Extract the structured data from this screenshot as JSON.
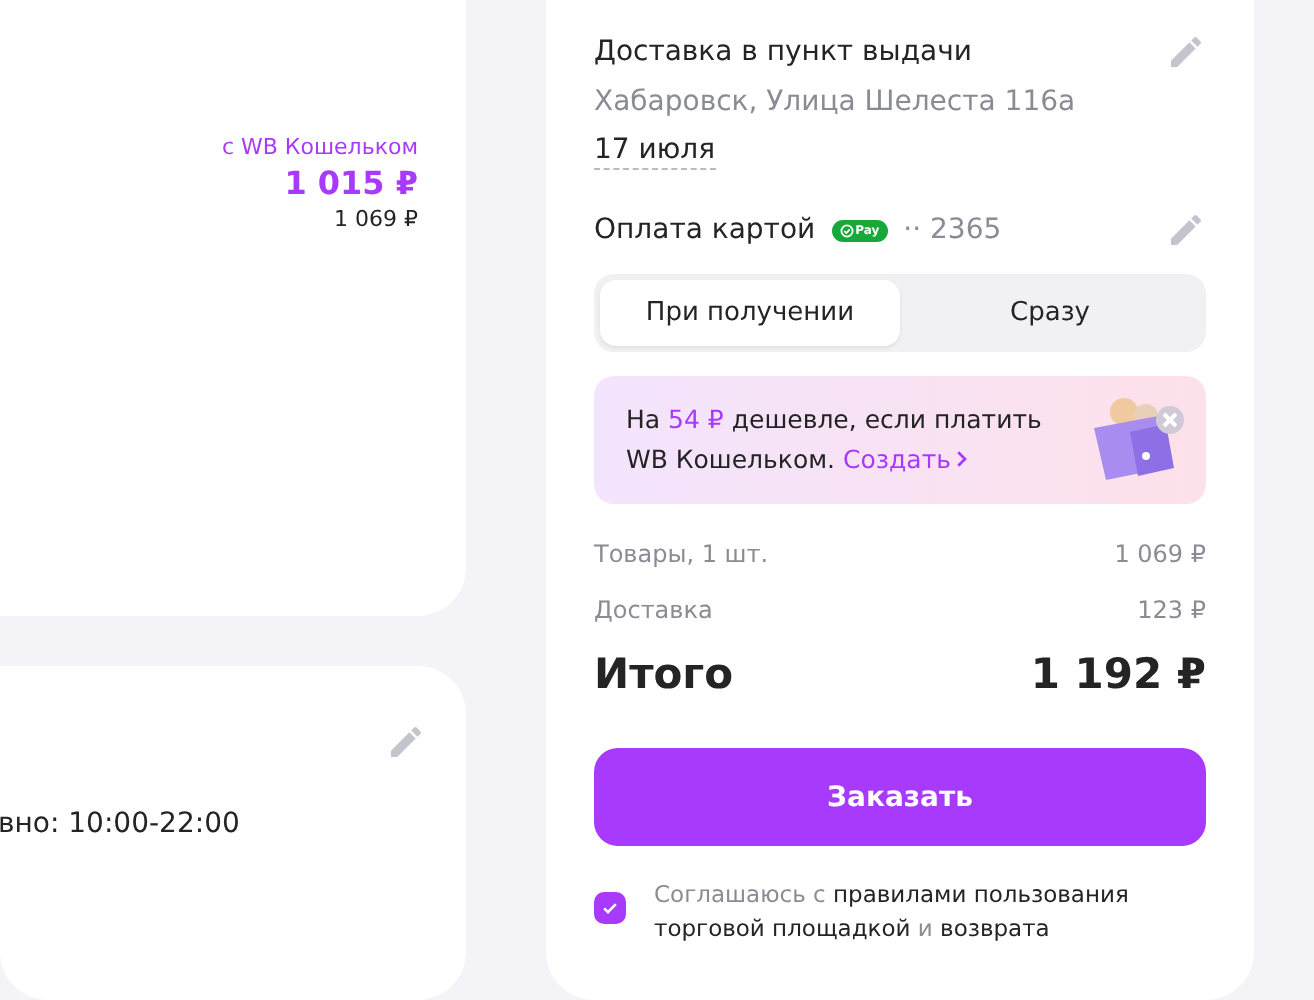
{
  "product_card": {
    "wallet_label": "с WB Кошельком",
    "wallet_price": "1 015 ₽",
    "price": "1 069 ₽"
  },
  "pickup_card": {
    "hours": "вно: 10:00-22:00"
  },
  "summary": {
    "delivery_title": "Доставка в пункт выдачи",
    "address": "Хабаровск, Улица Шелеста 116а",
    "date": "17 июля",
    "payment_title": "Оплата картой",
    "pay_badge": "Pay",
    "card_number": "·· 2365",
    "payment_options": [
      {
        "label": "При получении",
        "selected": true
      },
      {
        "label": "Сразу",
        "selected": false
      }
    ],
    "promo": {
      "prefix": "На ",
      "amount": "54 ₽",
      "suffix": " дешевле, если платить WB Кошельком. ",
      "link": "Создать"
    },
    "lines": [
      {
        "label": "Товары, 1 шт.",
        "value": "1 069 ₽"
      },
      {
        "label": "Доставка",
        "value": "123 ₽"
      }
    ],
    "total_label": "Итого",
    "total_value": "1 192 ₽",
    "order_button": "Заказать",
    "consent": {
      "checked": true,
      "parts": [
        {
          "text": "Соглашаюсь с ",
          "emphasis": false
        },
        {
          "text": "правилами пользования торговой площадкой",
          "emphasis": true
        },
        {
          "text": " и ",
          "emphasis": false
        },
        {
          "text": "возврата",
          "emphasis": true
        }
      ]
    }
  }
}
